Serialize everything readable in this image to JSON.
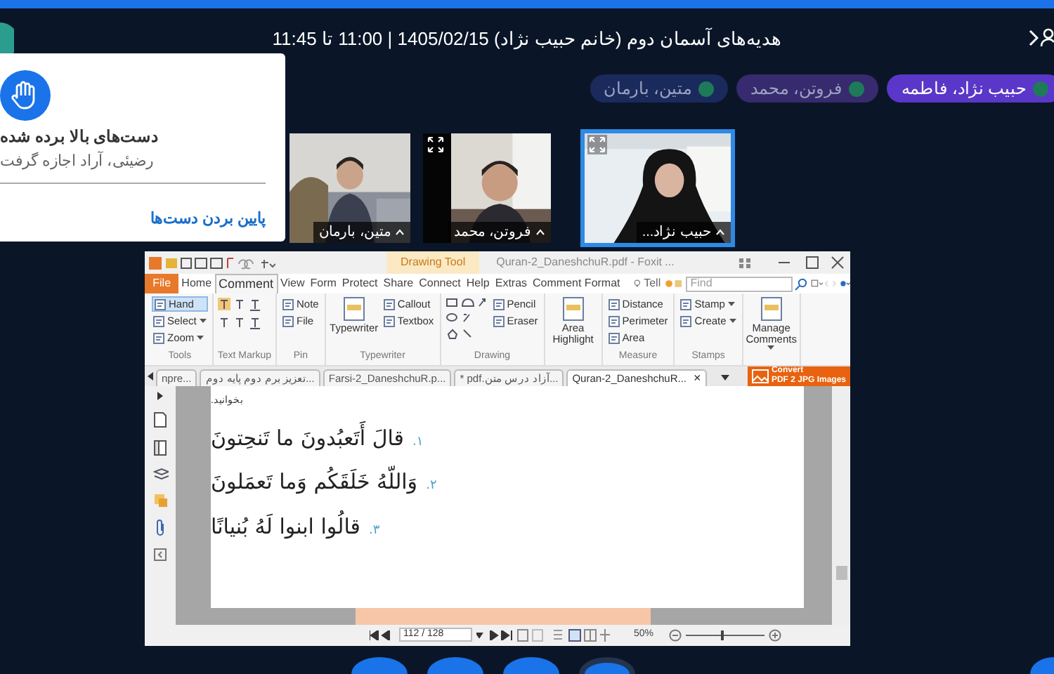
{
  "header": {
    "title": "هدیه‌های آسمان دوم (خانم حبیب نژاد) 1405/02/15 | 11:00 تا 11:45"
  },
  "participants": [
    {
      "name": "حبیب نژاد، فاطمه",
      "color": "#5a37c8"
    },
    {
      "name": "فروتن، محمد",
      "color": "#372a6e"
    },
    {
      "name": "متین، بارمان",
      "color": "#1b2a5c"
    }
  ],
  "notification": {
    "title": "دست‌های بالا برده شده",
    "message": "رضیئی، آراد اجازه گرفت",
    "action": "پایین بردن دست‌ها"
  },
  "videos": [
    {
      "name": "حبیب نژاد...",
      "selected": true,
      "expand_button": true
    },
    {
      "name": "فروتن، محمد",
      "selected": false,
      "expand_button": true
    },
    {
      "name": "متین، بارمان",
      "selected": false,
      "expand_button": false
    }
  ],
  "shared_app": {
    "contextual_tab": "Drawing Tool",
    "title": "Quran-2_DaneshchuR.pdf - Foxit ...",
    "menu": [
      {
        "label": "File",
        "kind": "file",
        "selected": false
      },
      {
        "label": "Home",
        "kind": "tab",
        "selected": false
      },
      {
        "label": "Comment",
        "kind": "tab",
        "selected": true
      },
      {
        "label": "View",
        "kind": "tab",
        "selected": false
      },
      {
        "label": "Form",
        "kind": "tab",
        "selected": false
      },
      {
        "label": "Protect",
        "kind": "tab",
        "selected": false
      },
      {
        "label": "Share",
        "kind": "tab",
        "selected": false
      },
      {
        "label": "Connect",
        "kind": "tab",
        "selected": false
      },
      {
        "label": "Help",
        "kind": "tab",
        "selected": false
      },
      {
        "label": "Extras",
        "kind": "tab",
        "selected": false
      },
      {
        "label": "Comment Format",
        "kind": "tab",
        "selected": false
      }
    ],
    "tell": "Tell",
    "find": {
      "placeholder": "Find"
    },
    "ribbon": [
      {
        "label": "Tools",
        "items": [
          {
            "kind": "small",
            "label": "Hand",
            "selected": true,
            "dropdown": false
          },
          {
            "kind": "small",
            "label": "Select",
            "selected": false,
            "dropdown": true
          },
          {
            "kind": "small",
            "label": "Zoom",
            "selected": false,
            "dropdown": true
          }
        ]
      },
      {
        "label": "Text Markup",
        "items": [
          {
            "kind": "markup"
          }
        ]
      },
      {
        "label": "Pin",
        "items": [
          {
            "kind": "small",
            "label": "Note",
            "selected": false,
            "dropdown": false
          },
          {
            "kind": "small",
            "label": "File",
            "selected": false,
            "dropdown": false
          }
        ]
      },
      {
        "label": "Typewriter",
        "items": [
          {
            "kind": "large",
            "label": "Typewriter",
            "dropdown": false
          },
          {
            "kind": "small",
            "label": "Callout",
            "selected": false,
            "dropdown": false
          },
          {
            "kind": "small",
            "label": "Textbox",
            "selected": false,
            "dropdown": false
          }
        ]
      },
      {
        "label": "Drawing",
        "items": [
          {
            "kind": "shapes"
          },
          {
            "kind": "small",
            "label": "Pencil",
            "selected": false,
            "dropdown": false
          },
          {
            "kind": "small",
            "label": "Eraser",
            "selected": false,
            "dropdown": false
          }
        ]
      },
      {
        "items": [
          {
            "kind": "large",
            "label": "Area Highlight",
            "dropdown": false
          }
        ]
      },
      {
        "label": "Measure",
        "items": [
          {
            "kind": "small",
            "label": "Distance",
            "selected": false,
            "dropdown": false
          },
          {
            "kind": "small",
            "label": "Perimeter",
            "selected": false,
            "dropdown": false
          },
          {
            "kind": "small",
            "label": "Area",
            "selected": false,
            "dropdown": false
          }
        ]
      },
      {
        "label": "Stamps",
        "items": [
          {
            "kind": "small",
            "label": "Stamp",
            "selected": false,
            "dropdown": true
          },
          {
            "kind": "small",
            "label": "Create",
            "selected": false,
            "dropdown": true
          }
        ]
      },
      {
        "items": [
          {
            "kind": "large",
            "label": "Manage Comments",
            "dropdown": true
          }
        ]
      }
    ],
    "doc_tabs": [
      {
        "label": "npre...",
        "selected": false
      },
      {
        "label": "...تعزیز برم دوم پایه دوم",
        "selected": false
      },
      {
        "label": "Farsi-2_DaneshchuR.p...",
        "selected": false
      },
      {
        "label": "...آزاد درس متن.pdf *",
        "selected": false
      },
      {
        "label": "Quran-2_DaneshchuR...",
        "selected": true,
        "close": "×"
      }
    ],
    "convert": {
      "line1": "Convert",
      "line2": "PDF 2 JPG Images"
    },
    "document": {
      "instruction": "بخوانید.",
      "verses": [
        {
          "number": "۱.",
          "text": "قالَ أَتَعبُدونَ ما تَنحِتونَ"
        },
        {
          "number": "۲.",
          "text": "وَاللّهُ خَلَقَكُم وَما تَعمَلونَ"
        },
        {
          "number": "۳.",
          "text": "قالُوا ابنوا لَهُ بُنيانًا"
        }
      ]
    },
    "nav": {
      "page": "112 / 128",
      "zoom": "50%",
      "zoom_slider": {
        "level": 0.45
      }
    }
  }
}
